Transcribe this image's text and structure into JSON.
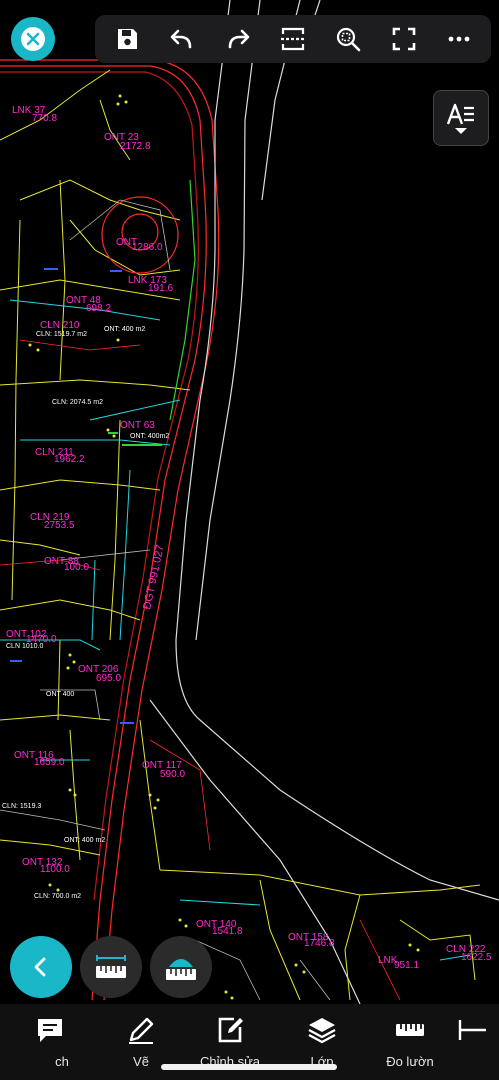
{
  "toolbar": {
    "icons": [
      "save-icon",
      "undo-icon",
      "redo-icon",
      "scan-icon",
      "zoom-extents-icon",
      "fullscreen-icon",
      "more-icon"
    ]
  },
  "text_toggle": {
    "icon": "text-style-icon"
  },
  "fabs": {
    "back": "chevron-left-icon",
    "measure": "ruler-icon",
    "area": "area-measure-icon"
  },
  "bottom_nav": [
    {
      "label": "ch",
      "icon": "comment-icon"
    },
    {
      "label": "Vẽ",
      "icon": "pencil-icon"
    },
    {
      "label": "Chỉnh sửa",
      "icon": "edit-icon"
    },
    {
      "label": "Lớp",
      "icon": "layers-icon"
    },
    {
      "label": "Đo lườn",
      "icon": "ruler-icon"
    },
    {
      "label": "",
      "icon": "dimension-icon"
    }
  ],
  "map_labels": {
    "l1": "LNK 37",
    "l2": "770.8",
    "l3": "ONT 23",
    "l4": "2172.8",
    "l5": "ONT",
    "l6": "1286.0",
    "l7": "LNK 173",
    "l8": "191.6",
    "l9": "ONT 48",
    "l10": "698.2",
    "l11": "CLN 210",
    "l12": "CLN: 1519.7 m2",
    "l13": "ONT: 400 m2",
    "l14": "CLN: 2074.5 m2",
    "l15": "ONT 63",
    "l16": "ONT: 400m2",
    "l17": "CLN 211",
    "l18": "1962.2",
    "l19": "CLN 219",
    "l20": "2753.5",
    "l21": "ONT 88",
    "l22": "100.0",
    "l23": "ĐGT 991.027",
    "l24": "ONT 102",
    "l25": "1470.0",
    "l26": "ONT 206",
    "l27": "695.0",
    "l28": "ONT 116",
    "l29": "1659.0",
    "l30": "ONT 117",
    "l31": "590.0",
    "l32": "ONT: 400 m2",
    "l33": "ONT 132",
    "l34": "1100.0",
    "l35": "CLN: 700.0 m2",
    "l36": "ONT 140",
    "l37": "1541.8",
    "l38": "ONT 158",
    "l39": "1746.8",
    "l40": "LNK",
    "l41": "951.1",
    "l42": "CLN 222",
    "l43": "1622.5",
    "l44": "ONT 400",
    "l45": "CLN: 1519.3",
    "l46": "CLN 1010.0"
  }
}
